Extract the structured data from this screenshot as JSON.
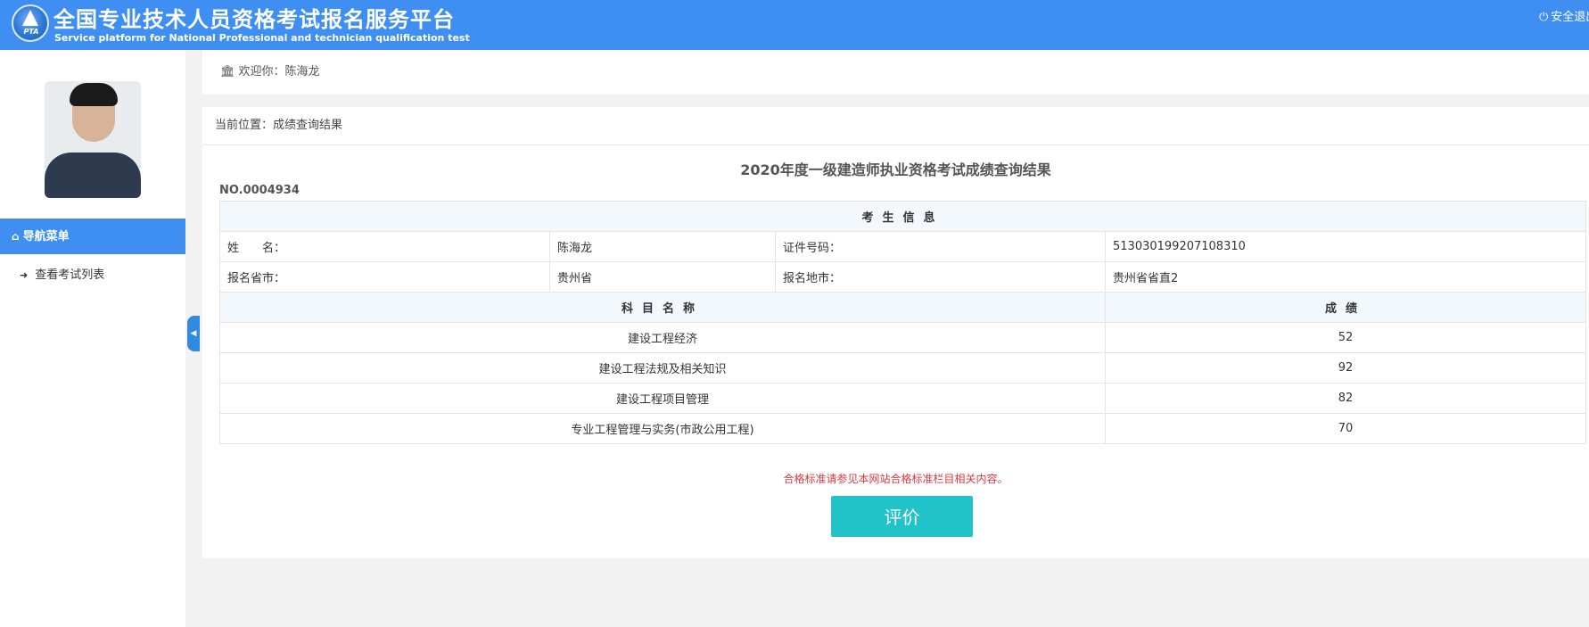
{
  "header": {
    "logo_text": "PTA",
    "title_cn": "全国专业技术人员资格考试报名服务平台",
    "title_en": "Service platform for National Professional and technician qualification test",
    "logout_label": "安全退出",
    "logout_icon": "power-icon"
  },
  "sidebar": {
    "nav_title": "导航菜单",
    "nav_title_icon": "home-icon",
    "items": [
      {
        "label": "查看考试列表",
        "icon": "sign-in-icon"
      }
    ]
  },
  "welcome": {
    "icon": "bank-icon",
    "text": "欢迎你：陈海龙"
  },
  "breadcrumb": "当前位置：成绩查询结果",
  "report": {
    "title": "2020年度一级建造师执业资格考试成绩查询结果",
    "no": "NO.0004934",
    "candidate_header": "考生信息",
    "name_label": "姓　　名：",
    "name_value": "陈海龙",
    "id_label": "证件号码：",
    "id_value": "513030199207108310",
    "province_label": "报名省市：",
    "province_value": "贵州省",
    "city_label": "报名地市：",
    "city_value": "贵州省省直2",
    "subject_header": "科目名称",
    "score_header": "成绩",
    "subjects": [
      {
        "name": "建设工程经济",
        "score": "52"
      },
      {
        "name": "建设工程法规及相关知识",
        "score": "92"
      },
      {
        "name": "建设工程项目管理",
        "score": "82"
      },
      {
        "name": "专业工程管理与实务(市政公用工程)",
        "score": "70"
      }
    ],
    "notice": "合格标准请参见本网站合格标准栏目相关内容。",
    "evaluate_label": "评价"
  },
  "colors": {
    "header_bg": "#3f8ff2",
    "notice": "#d9393a",
    "evaluate_button": "#22c3c8"
  }
}
